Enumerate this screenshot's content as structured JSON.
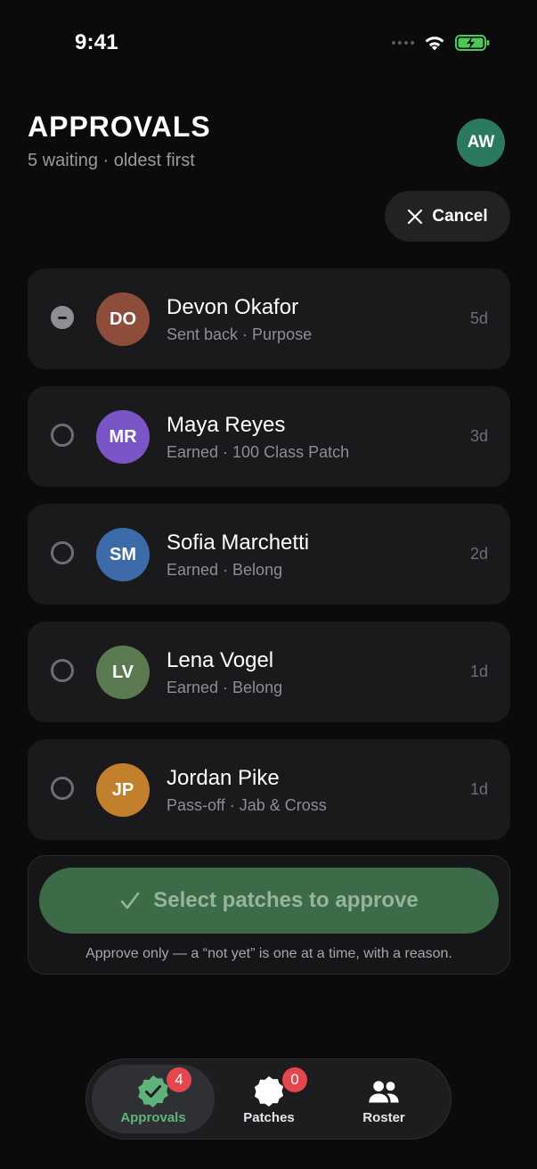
{
  "status": {
    "time": "9:41"
  },
  "header": {
    "title": "APPROVALS",
    "subtitle": "5 waiting · oldest first",
    "user_initials": "AW",
    "cancel_label": "Cancel"
  },
  "requests": [
    {
      "initials": "DO",
      "name": "Devon Okafor",
      "meta": "Sent back · Purpose",
      "age": "5d",
      "color": "#8e4c3a",
      "state": "mixed"
    },
    {
      "initials": "MR",
      "name": "Maya Reyes",
      "meta": "Earned · 100 Class Patch",
      "age": "3d",
      "color": "#7a55c8",
      "state": "empty"
    },
    {
      "initials": "SM",
      "name": "Sofia Marchetti",
      "meta": "Earned · Belong",
      "age": "2d",
      "color": "#3d6aa8",
      "state": "empty"
    },
    {
      "initials": "LV",
      "name": "Lena Vogel",
      "meta": "Earned · Belong",
      "age": "1d",
      "color": "#5b7a52",
      "state": "empty"
    },
    {
      "initials": "JP",
      "name": "Jordan Pike",
      "meta": "Pass-off · Jab & Cross",
      "age": "1d",
      "color": "#c2802d",
      "state": "empty"
    }
  ],
  "approve": {
    "button_label": "Select patches to approve",
    "note": "Approve only — a “not yet” is one at a time, with a reason."
  },
  "tabs": [
    {
      "label": "Approvals",
      "badge": "4",
      "icon": "check-seal-icon",
      "active": true
    },
    {
      "label": "Patches",
      "badge": "0",
      "icon": "patch-icon",
      "active": false
    },
    {
      "label": "Roster",
      "badge": "",
      "icon": "people-icon",
      "active": false
    }
  ],
  "colors": {
    "accent": "#5fb37a",
    "badge": "#e5474d",
    "approve_bg": "#3c6b47"
  }
}
